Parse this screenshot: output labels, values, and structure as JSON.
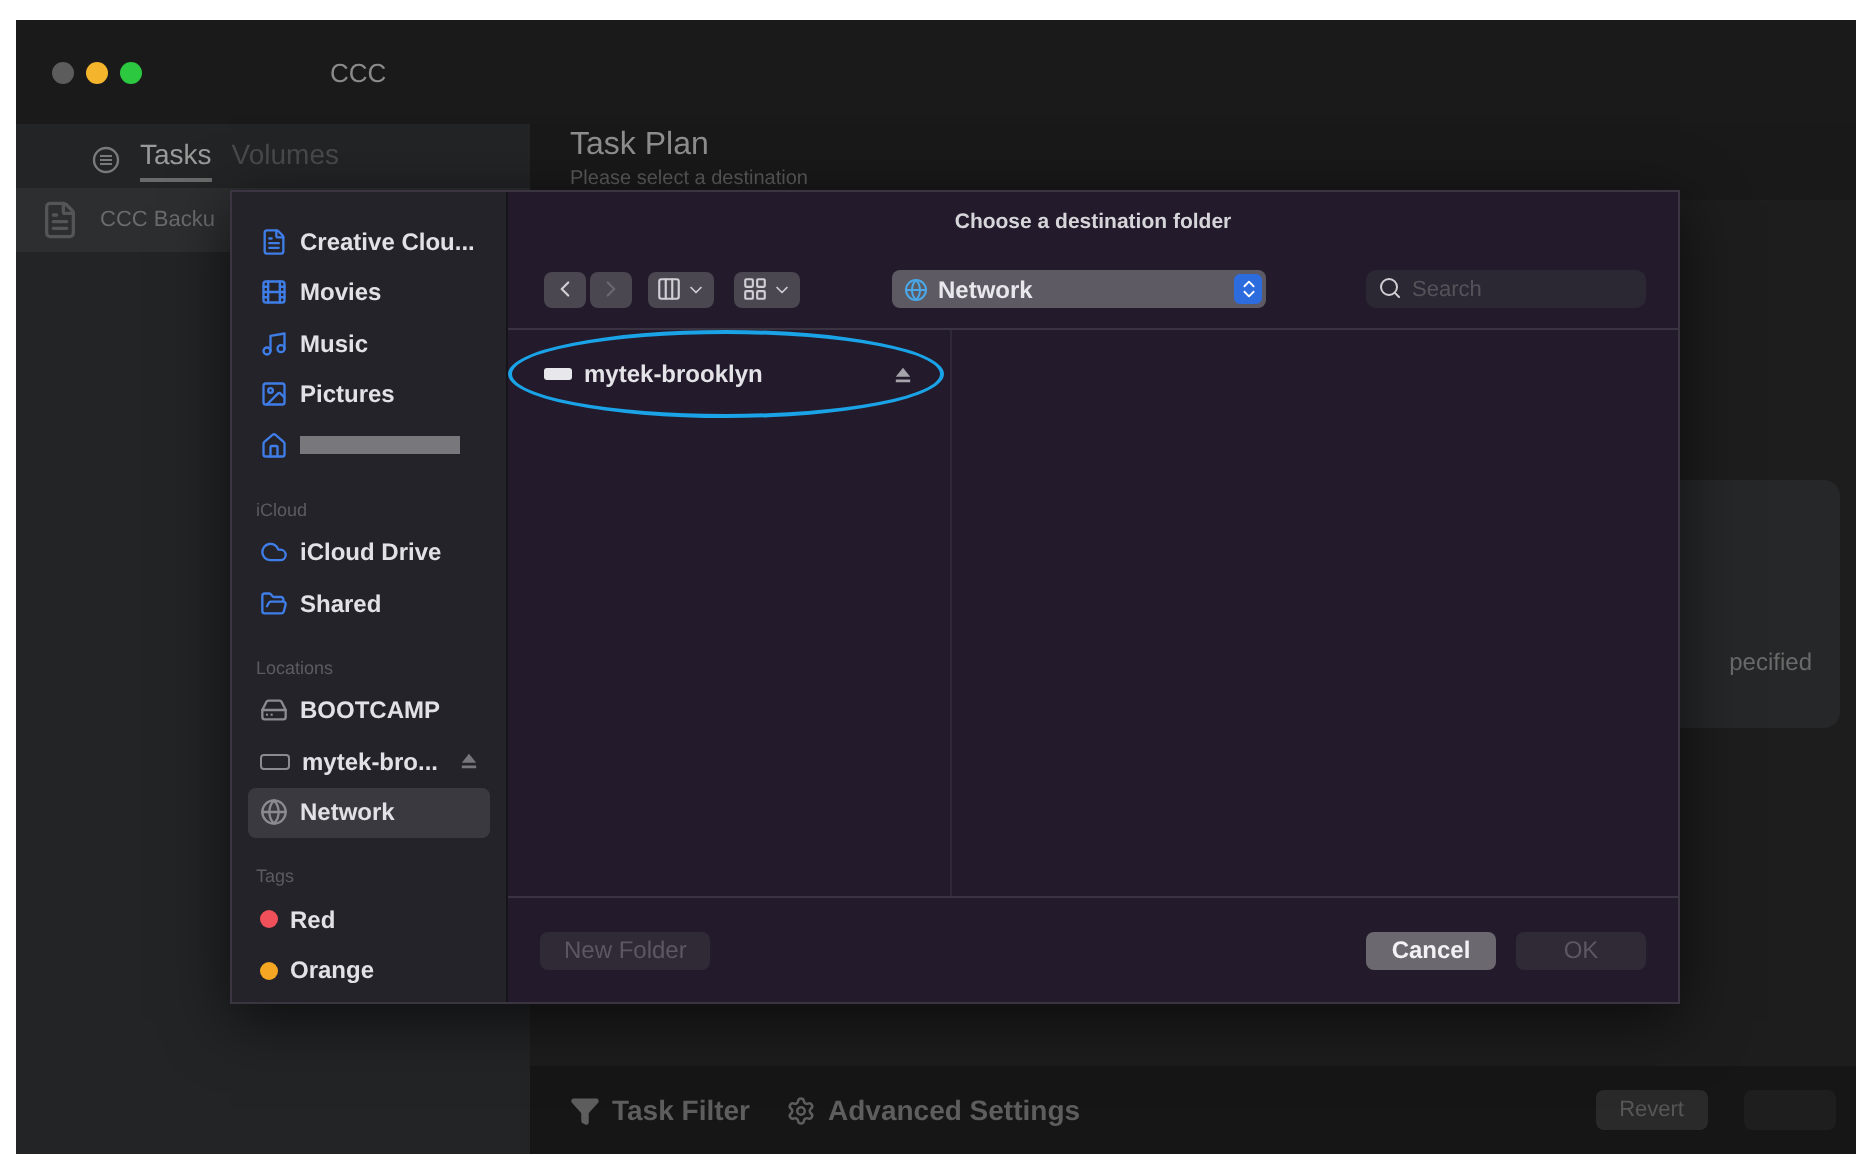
{
  "window": {
    "title": "CCC",
    "traffic_lights": [
      {
        "color": "#5c5c5c"
      },
      {
        "color": "#f4b42c"
      },
      {
        "color": "#2bc840"
      }
    ]
  },
  "app_sidebar": {
    "tabs": [
      {
        "label": "Tasks",
        "selected": true
      },
      {
        "label": "Volumes",
        "selected": false
      }
    ],
    "items": [
      {
        "label": "CCC Backu"
      }
    ]
  },
  "main": {
    "title": "Task Plan",
    "subtitle": "Please select a destination",
    "card_text": "pecified"
  },
  "bottom_bar": {
    "items": [
      {
        "label": "Task Filter",
        "kind": "filter"
      },
      {
        "label": "Advanced Settings",
        "kind": "settings"
      }
    ],
    "buttons": [
      {
        "label": "Revert",
        "disabled": false
      }
    ]
  },
  "dialog": {
    "title": "Choose a destination folder",
    "sidebar": [
      {
        "items": [
          {
            "label": "Creative Clou...",
            "kind": "document",
            "selected": false
          },
          {
            "label": "Movies",
            "kind": "movies",
            "selected": false
          },
          {
            "label": "Music",
            "kind": "music",
            "selected": false
          },
          {
            "label": "Pictures",
            "kind": "pictures",
            "selected": false
          },
          {
            "kind": "home",
            "redacted": true,
            "selected": false
          }
        ]
      },
      {
        "heading": "iCloud",
        "items": [
          {
            "label": "iCloud Drive",
            "kind": "cloud",
            "selected": false
          },
          {
            "label": "Shared",
            "kind": "shared",
            "selected": false
          }
        ]
      },
      {
        "heading": "Locations",
        "items": [
          {
            "label": "BOOTCAMP",
            "kind": "drive",
            "selected": false
          },
          {
            "label": "mytek-bro...",
            "kind": "external",
            "eject": true,
            "selected": false
          },
          {
            "label": "Network",
            "kind": "network",
            "selected": true
          }
        ]
      },
      {
        "heading": "Tags",
        "items": [
          {
            "label": "Red",
            "kind": "tag",
            "color": "#f0505a",
            "selected": false
          },
          {
            "label": "Orange",
            "kind": "tag",
            "color": "#f5a623",
            "selected": false
          }
        ]
      }
    ],
    "location": "Network",
    "search": {
      "placeholder": "Search"
    },
    "files": [
      {
        "name": "mytek-brooklyn",
        "eject": true,
        "highlighted": true
      }
    ],
    "buttons": [
      {
        "label": "New Folder",
        "disabled": true,
        "kind": "secondary"
      },
      {
        "label": "Cancel",
        "disabled": false,
        "kind": "cancel"
      },
      {
        "label": "OK",
        "disabled": true,
        "kind": "ok"
      }
    ]
  }
}
